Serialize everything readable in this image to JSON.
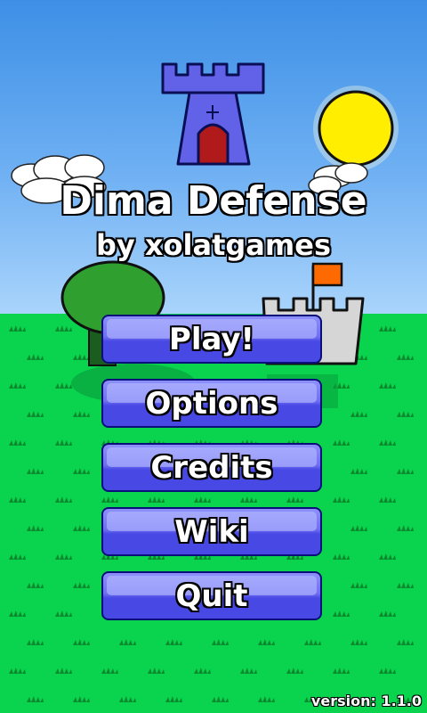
{
  "title": "Dima Defense",
  "subtitle": "by xolatgames",
  "menu": {
    "play": "Play!",
    "options": "Options",
    "credits": "Credits",
    "wiki": "Wiki",
    "quit": "Quit"
  },
  "version": "version: 1.1.0",
  "colors": {
    "sky": "#3d8fe6",
    "grass": "#0ad44e",
    "button": "#5a5aee",
    "sun": "#ffee00",
    "tower": "#6262e8",
    "flag": "#ff6a00"
  },
  "icons": [
    "tower-icon",
    "sun-icon",
    "cloud-icon",
    "tree-icon",
    "castle-icon",
    "flag-icon",
    "grass-tuft-icon"
  ]
}
